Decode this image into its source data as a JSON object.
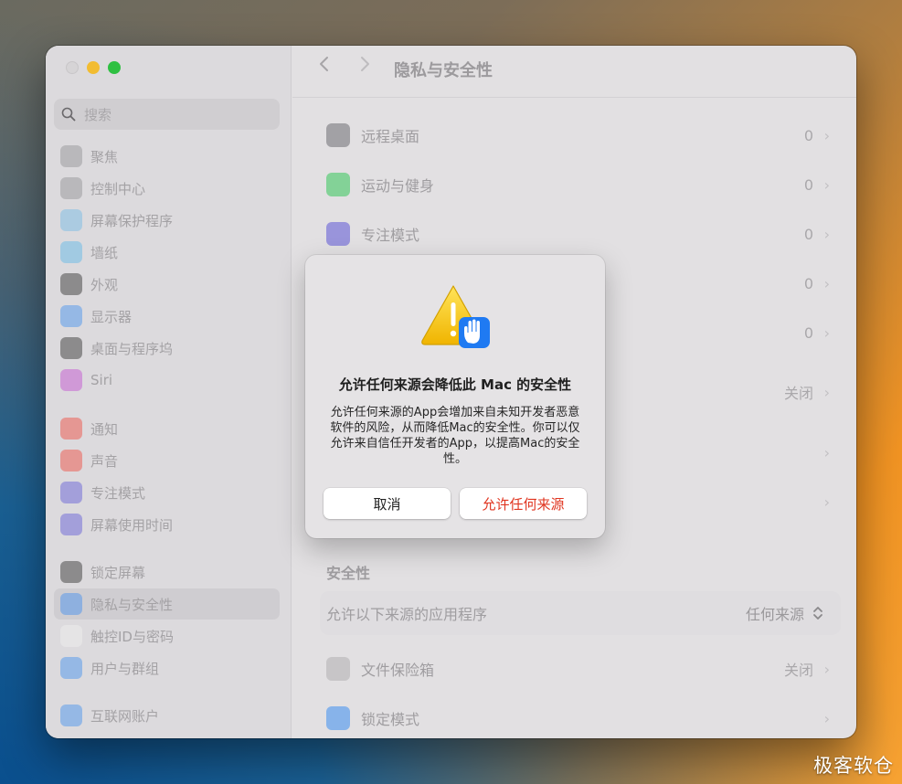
{
  "window": {
    "title": "隐私与安全性"
  },
  "sidebar": {
    "search_placeholder": "搜索",
    "items": [
      {
        "label": "聚焦",
        "icon": "spotlight-icon",
        "color": "#8e8e92"
      },
      {
        "label": "控制中心",
        "icon": "control-center-icon",
        "color": "#8e8e92"
      },
      {
        "label": "屏幕保护程序",
        "icon": "screensaver-icon",
        "color": "#6fb8e6"
      },
      {
        "label": "墙纸",
        "icon": "wallpaper-icon",
        "color": "#58b6e8"
      },
      {
        "label": "外观",
        "icon": "appearance-icon",
        "color": "#2a2a2a"
      },
      {
        "label": "显示器",
        "icon": "display-icon",
        "color": "#3d8ef0"
      },
      {
        "label": "桌面与程序坞",
        "icon": "dock-icon",
        "color": "#2a2a2a"
      },
      {
        "label": "Siri",
        "icon": "siri-icon",
        "color": "#c04ad0"
      },
      {
        "label": "通知",
        "icon": "notification-icon",
        "color": "#f0453a"
      },
      {
        "label": "声音",
        "icon": "sound-icon",
        "color": "#f0453a"
      },
      {
        "label": "专注模式",
        "icon": "focus-icon",
        "color": "#5d56d6"
      },
      {
        "label": "屏幕使用时间",
        "icon": "screen-time-icon",
        "color": "#5d56d6"
      },
      {
        "label": "锁定屏幕",
        "icon": "lock-screen-icon",
        "color": "#2a2a2a"
      },
      {
        "label": "隐私与安全性",
        "icon": "privacy-hand-icon",
        "color": "#3d8ef0"
      },
      {
        "label": "触控ID与密码",
        "icon": "touch-id-icon",
        "color": "#f0f0f0"
      },
      {
        "label": "用户与群组",
        "icon": "users-icon",
        "color": "#3d8ef0"
      },
      {
        "label": "互联网账户",
        "icon": "internet-accounts-icon",
        "color": "#3d8ef0"
      }
    ],
    "active_label": "隐私与安全性"
  },
  "main": {
    "rows": [
      {
        "label": "远程桌面",
        "value": "0",
        "icon": "remote-desktop-icon",
        "color": "#6e6e72"
      },
      {
        "label": "运动与健身",
        "value": "0",
        "icon": "fitness-icon",
        "color": "#34c759"
      },
      {
        "label": "专注模式",
        "value": "0",
        "icon": "focus-moon-icon",
        "color": "#5d56d6"
      },
      {
        "label": "",
        "value": "0"
      },
      {
        "label": "",
        "value": "0"
      },
      {
        "label": "",
        "value": "关闭"
      },
      {
        "label": "",
        "value": ""
      },
      {
        "label": "",
        "value": ""
      }
    ],
    "security_title": "安全性",
    "allow_from_label": "允许以下来源的应用程序",
    "allow_from_value": "任何来源",
    "bottom_rows": [
      {
        "label": "文件保险箱",
        "value": "关闭",
        "icon": "filevault-icon",
        "color": "#b0aeb1"
      },
      {
        "label": "锁定模式",
        "value": "",
        "icon": "lockdown-hand-icon",
        "color": "#3d8ef0"
      }
    ]
  },
  "dialog": {
    "title": "允许任何来源会降低此 Mac 的安全性",
    "body": "允许任何来源的App会增加来自未知开发者恶意软件的风险，从而降低Mac的安全性。你可以仅允许来自信任开发者的App，以提高Mac的安全性。",
    "cancel_label": "取消",
    "allow_label": "允许任何来源"
  },
  "watermark": "极客软仓"
}
